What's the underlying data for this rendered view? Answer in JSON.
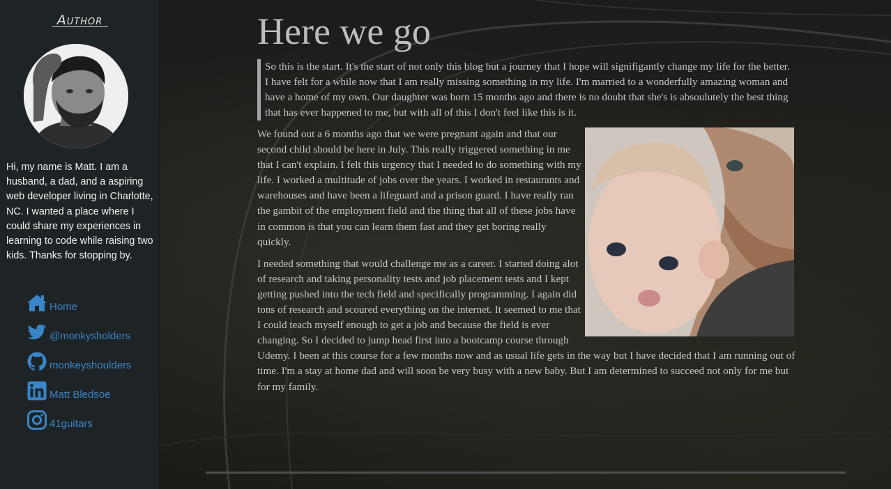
{
  "sidebar": {
    "title": "Author",
    "bio": "Hi, my name is Matt. I am a husband, a dad, and a aspiring web developer living in Charlotte, NC. I wanted a place where I could share my experiences in learning to code while raising two kids. Thanks for stopping by.",
    "nav": [
      {
        "label": "Home",
        "icon": "home-icon"
      },
      {
        "label": "@monkysholders",
        "icon": "twitter-icon"
      },
      {
        "label": "monkeyshoulders",
        "icon": "github-icon"
      },
      {
        "label": "Matt Bledsoe",
        "icon": "linkedin-icon"
      },
      {
        "label": "41guitars",
        "icon": "instagram-icon"
      }
    ],
    "link_color": "#3a85c7"
  },
  "post": {
    "title": "Here we go",
    "intro": "So this is the start. It's the start of not only this blog but a journey that I hope will signifigantly change my life for the better. I have felt for a while now that I am really missing something in my life. I'm married to a wonderfully amazing woman and have a home of my own. Our daughter was born 15 months ago and there is no doubt that she's is absoulutely the best thing that has ever happened to me, but with all of this I don't feel like this is it.",
    "paragraphs": [
      "We found out a 6 months ago that we were pregnant again and that our second child should be here in July. This really triggered something in me that I can't explain. I felt this urgency that I needed to do something with my life. I worked a multitude of jobs over the years. I worked in restaurants and warehouses and have been a lifeguard and a prison guard. I have really ran the gambit of the employment field and the thing that all of these jobs have in common is that you can learn them fast and they get boring really quickly.",
      "I needed something that would challenge me as a career. I started doing alot of research and taking personality tests and job placement tests and I kept getting pushed into the tech field and specifically programming. I again did tons of research and scoured everything on the internet. It seemed to me that I could teach myself enough to get a job and because the field is ever changing. So I decided to jump head first into a bootcamp course through Udemy. I been at this course for a few months now and as usual life gets in the way but I have decided that I am running out of time. I'm a stay at home dad and will soon be very busy with a new baby. But I am determined to succeed not only for me but for my family."
    ]
  }
}
